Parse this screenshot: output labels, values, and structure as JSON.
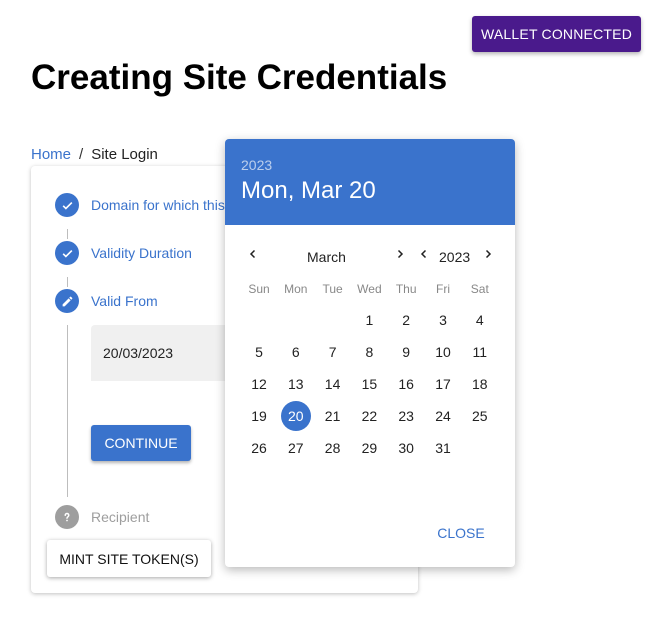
{
  "header": {
    "wallet_button": "WALLET CONNECTED",
    "title": "Creating Site Credentials"
  },
  "breadcrumb": {
    "home": "Home",
    "separator": "/",
    "current": "Site Login"
  },
  "stepper": {
    "steps": [
      {
        "label": "Domain for which this",
        "icon": "check-icon",
        "state": "completed"
      },
      {
        "label": "Validity Duration",
        "icon": "check-icon",
        "state": "completed"
      },
      {
        "label": "Valid From",
        "icon": "pencil-icon",
        "state": "active"
      },
      {
        "label": "Recipient",
        "icon": "question-icon",
        "state": "disabled"
      }
    ],
    "date_value": "20/03/2023",
    "continue_label": "CONTINUE",
    "mint_label": "MINT SITE TOKEN(S)"
  },
  "date_picker": {
    "header_year": "2023",
    "header_date": "Mon, Mar 20",
    "month": "March",
    "year": "2023",
    "weekdays": [
      "Sun",
      "Mon",
      "Tue",
      "Wed",
      "Thu",
      "Fri",
      "Sat"
    ],
    "weeks": [
      [
        "",
        "",
        "",
        "1",
        "2",
        "3",
        "4"
      ],
      [
        "5",
        "6",
        "7",
        "8",
        "9",
        "10",
        "11"
      ],
      [
        "12",
        "13",
        "14",
        "15",
        "16",
        "17",
        "18"
      ],
      [
        "19",
        "20",
        "21",
        "22",
        "23",
        "24",
        "25"
      ],
      [
        "26",
        "27",
        "28",
        "29",
        "30",
        "31",
        ""
      ]
    ],
    "selected_day": "20",
    "close_label": "CLOSE"
  },
  "colors": {
    "primary": "#3a73cc",
    "wallet": "#4a1a8c",
    "disabled": "#9e9e9e"
  }
}
